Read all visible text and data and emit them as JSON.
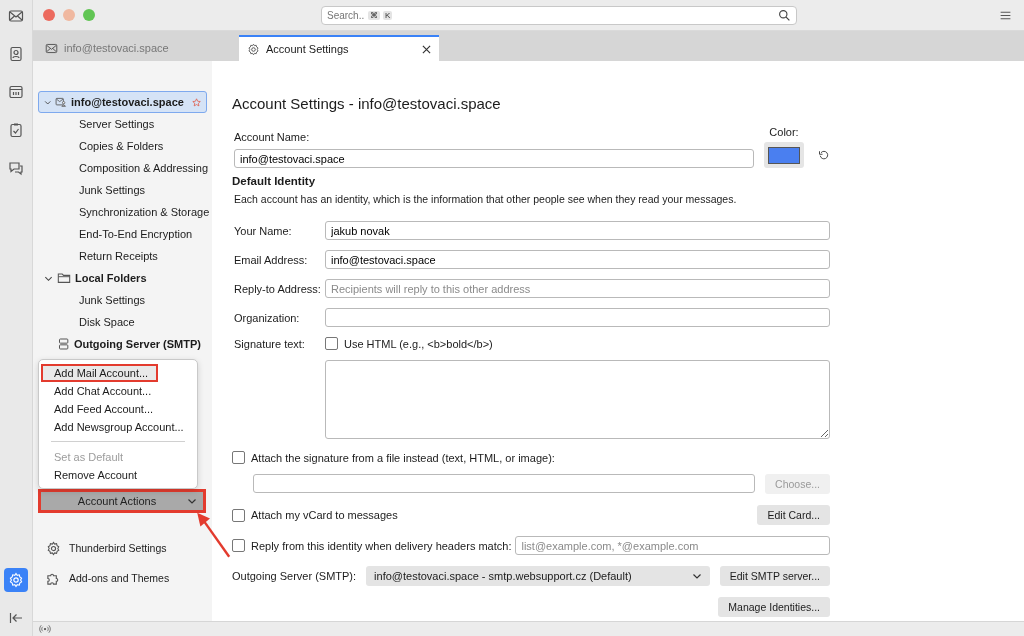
{
  "spaces": [
    {
      "kind": "mail",
      "selected": false
    },
    {
      "kind": "contacts",
      "selected": false
    },
    {
      "kind": "calendar",
      "selected": false
    },
    {
      "kind": "tasks",
      "selected": false
    },
    {
      "kind": "chat",
      "selected": false
    }
  ],
  "spaces_bottom": [
    {
      "kind": "settings",
      "selected": true
    },
    {
      "kind": "collapse",
      "selected": false
    }
  ],
  "search": {
    "placeholder": "Search...",
    "keys": [
      "⌘",
      "K"
    ]
  },
  "tabs": [
    {
      "label": "info@testovaci.space",
      "kind": "mail",
      "selected": false
    },
    {
      "label": "Account Settings",
      "kind": "settings",
      "selected": true
    }
  ],
  "account_tree": [
    {
      "label": "info@testovaci.space",
      "kind": "account",
      "expanded": true,
      "selected": true,
      "default": true,
      "children": [
        {
          "label": "Server Settings"
        },
        {
          "label": "Copies & Folders"
        },
        {
          "label": "Composition & Addressing"
        },
        {
          "label": "Junk Settings"
        },
        {
          "label": "Synchronization & Storage"
        },
        {
          "label": "End-To-End Encryption"
        },
        {
          "label": "Return Receipts"
        }
      ]
    },
    {
      "label": "Local Folders",
      "kind": "folders",
      "expanded": true,
      "selected": false,
      "children": [
        {
          "label": "Junk Settings"
        },
        {
          "label": "Disk Space"
        }
      ]
    },
    {
      "label": "Outgoing Server (SMTP)",
      "kind": "server",
      "selected": false
    }
  ],
  "account_actions": {
    "label": "Account Actions",
    "expanded": true,
    "annotated": true,
    "menu": [
      {
        "kind": "item",
        "label": "Add Mail Account...",
        "disabled": false,
        "annotated": true
      },
      {
        "kind": "item",
        "label": "Add Chat Account...",
        "disabled": false,
        "annotated": false
      },
      {
        "kind": "item",
        "label": "Add Feed Account...",
        "disabled": false,
        "annotated": false
      },
      {
        "kind": "item",
        "label": "Add Newsgroup Account...",
        "disabled": false,
        "annotated": false
      },
      {
        "kind": "separator"
      },
      {
        "kind": "item",
        "label": "Set as Default",
        "disabled": true,
        "annotated": false
      },
      {
        "kind": "item",
        "label": "Remove Account",
        "disabled": false,
        "annotated": false
      }
    ]
  },
  "sidebar_footer": [
    {
      "kind": "settings",
      "label": "Thunderbird Settings"
    },
    {
      "kind": "addons",
      "label": "Add-ons and Themes"
    }
  ],
  "main": {
    "title": "Account Settings - info@testovaci.space",
    "account_name": {
      "label": "Account Name:",
      "value": "info@testovaci.space"
    },
    "color": {
      "label": "Color:",
      "color": "#4a7ff0"
    },
    "identity_heading": "Default Identity",
    "identity_description": "Each account has an identity, which is the information that other people see when they read your messages.",
    "fields": [
      {
        "label": "Your Name:",
        "value": "jakub novak"
      },
      {
        "label": "Email Address:",
        "value": "info@testovaci.space"
      },
      {
        "label": "Reply-to Address:",
        "placeholder": "Recipients will reply to this other address"
      },
      {
        "label": "Organization:"
      }
    ],
    "signature": {
      "label": "Signature text:",
      "checkbox_label": "Use HTML (e.g., <b>bold</b>)",
      "checked": false
    },
    "attach_signature": {
      "label": "Attach the signature from a file instead (text, HTML, or image):",
      "checked": false,
      "button": "Choose...",
      "button_disabled": true
    },
    "vcard": {
      "label": "Attach my vCard to messages",
      "checked": false,
      "button": "Edit Card..."
    },
    "reply_match": {
      "label": "Reply from this identity when delivery headers match:",
      "checked": false,
      "placeholder": "list@example.com, *@example.com"
    },
    "outgoing": {
      "label": "Outgoing Server (SMTP):",
      "value": "info@testovaci.space - smtp.websupport.cz (Default)",
      "button": "Edit SMTP server..."
    },
    "manage_button": "Manage Identities..."
  }
}
